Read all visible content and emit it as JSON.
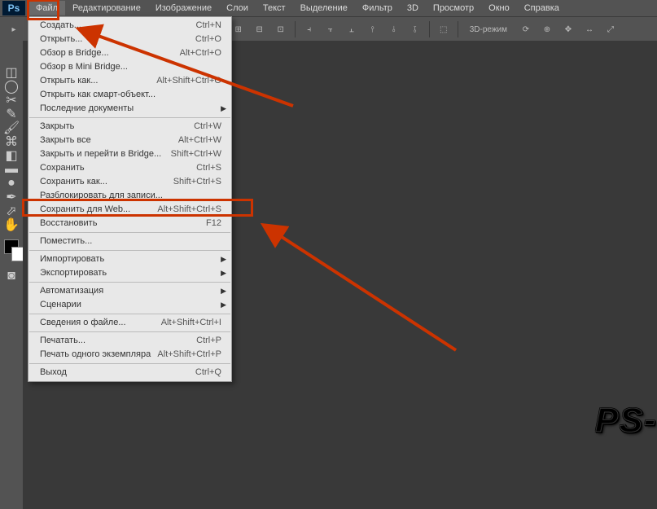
{
  "app": {
    "logo": "Ps"
  },
  "menubar": {
    "items": [
      "Файл",
      "Редактирование",
      "Изображение",
      "Слои",
      "Текст",
      "Выделение",
      "Фильтр",
      "3D",
      "Просмотр",
      "Окно",
      "Справка"
    ],
    "activeIndex": 0
  },
  "toolbar": {
    "mode_label": "3D-режим"
  },
  "dropdown": {
    "groups": [
      [
        {
          "label": "Создать...",
          "shortcut": "Ctrl+N"
        },
        {
          "label": "Открыть...",
          "shortcut": "Ctrl+O"
        },
        {
          "label": "Обзор в Bridge...",
          "shortcut": "Alt+Ctrl+O"
        },
        {
          "label": "Обзор в Mini Bridge..."
        },
        {
          "label": "Открыть как...",
          "shortcut": "Alt+Shift+Ctrl+O"
        },
        {
          "label": "Открыть как смарт-объект..."
        },
        {
          "label": "Последние документы",
          "submenu": true
        }
      ],
      [
        {
          "label": "Закрыть",
          "shortcut": "Ctrl+W"
        },
        {
          "label": "Закрыть все",
          "shortcut": "Alt+Ctrl+W"
        },
        {
          "label": "Закрыть и перейти в Bridge...",
          "shortcut": "Shift+Ctrl+W"
        },
        {
          "label": "Сохранить",
          "shortcut": "Ctrl+S"
        },
        {
          "label": "Сохранить как...",
          "shortcut": "Shift+Ctrl+S"
        },
        {
          "label": "Разблокировать для записи..."
        },
        {
          "label": "Сохранить для Web...",
          "shortcut": "Alt+Shift+Ctrl+S"
        },
        {
          "label": "Восстановить",
          "shortcut": "F12"
        }
      ],
      [
        {
          "label": "Поместить..."
        }
      ],
      [
        {
          "label": "Импортировать",
          "submenu": true
        },
        {
          "label": "Экспортировать",
          "submenu": true
        }
      ],
      [
        {
          "label": "Автоматизация",
          "submenu": true
        },
        {
          "label": "Сценарии",
          "submenu": true
        }
      ],
      [
        {
          "label": "Сведения о файле...",
          "shortcut": "Alt+Shift+Ctrl+I"
        }
      ],
      [
        {
          "label": "Печатать...",
          "shortcut": "Ctrl+P"
        },
        {
          "label": "Печать одного экземпляра",
          "shortcut": "Alt+Shift+Ctrl+P"
        }
      ],
      [
        {
          "label": "Выход",
          "shortcut": "Ctrl+Q"
        }
      ]
    ]
  },
  "watermark": "PS-"
}
